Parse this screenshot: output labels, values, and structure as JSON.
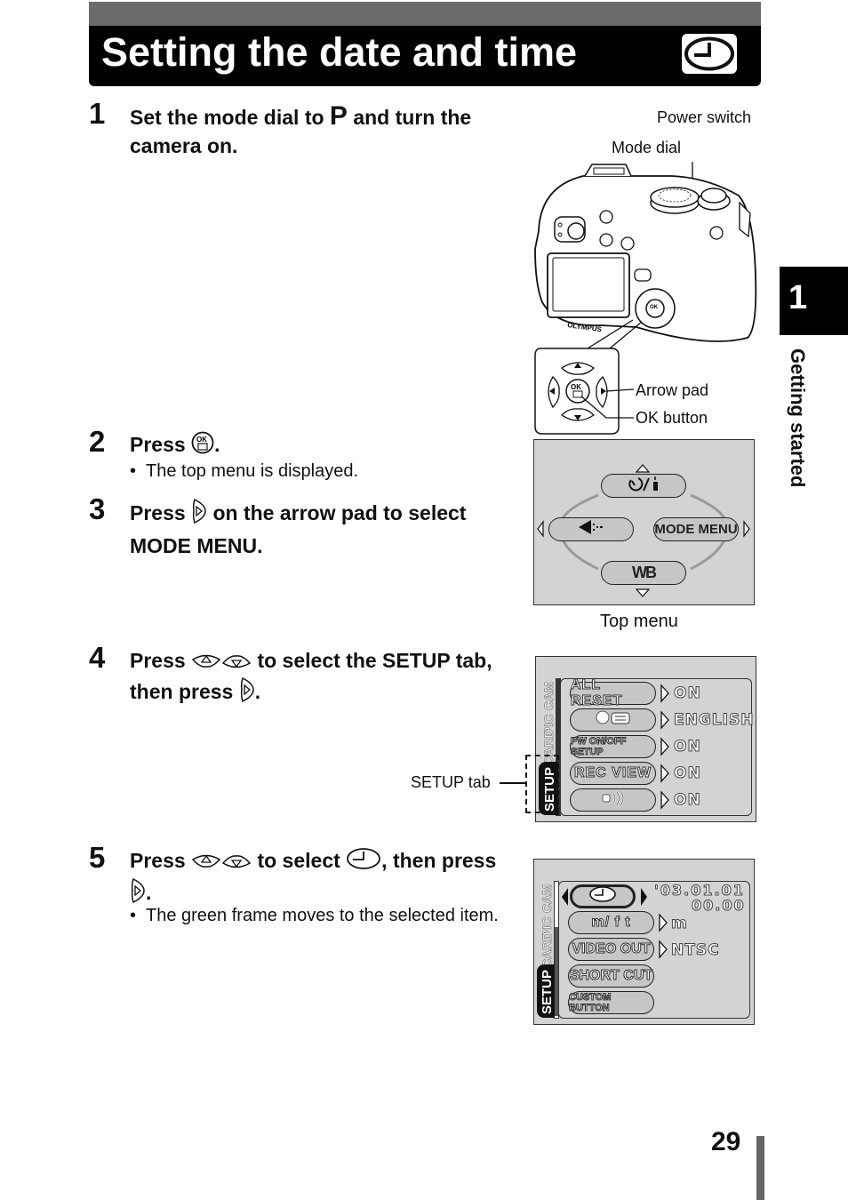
{
  "header": {
    "title": "Setting the date and time",
    "icon": "clock-icon"
  },
  "chapter": {
    "number": "1",
    "label": "Getting started"
  },
  "steps": [
    {
      "number": "1",
      "text_before": "Set the mode dial to ",
      "mode_glyph": "P",
      "text_after": " and turn the camera on."
    },
    {
      "number": "2",
      "text_before": "Press ",
      "icon": "ok-button-icon",
      "text_after": ".",
      "bullet": "The top menu is displayed."
    },
    {
      "number": "3",
      "text_before": "Press ",
      "icon": "right-arrow-button-icon",
      "text_after": " on the arrow pad to select MODE MENU."
    },
    {
      "number": "4",
      "text_before": "Press ",
      "icons": [
        "up-arrow-button-icon",
        "down-arrow-button-icon"
      ],
      "text_mid": " to select the SETUP tab, then press ",
      "icon2": "right-arrow-button-icon",
      "text_after": "."
    },
    {
      "number": "5",
      "text_before": "Press ",
      "icons": [
        "up-arrow-button-icon",
        "down-arrow-button-icon"
      ],
      "text_mid": " to select ",
      "icon2": "clock-icon",
      "text_mid2": ", then press ",
      "icon3": "right-arrow-button-icon",
      "text_after": ".",
      "bullet": "The green frame moves to the selected item."
    }
  ],
  "camera_figure": {
    "labels": {
      "power_switch": "Power switch",
      "mode_dial": "Mode dial",
      "arrow_pad": "Arrow pad",
      "ok_button": "OK button"
    },
    "brand": "OLYMPUS",
    "ok_text": "OK"
  },
  "top_menu": {
    "caption": "Top menu",
    "items": {
      "up": "self-timer-remote-icon",
      "left": "flash-compensation-icon",
      "right": "MODE  MENU",
      "down": "WB"
    }
  },
  "setup_screen_1": {
    "callout": "SETUP tab",
    "tabs": [
      "CAM",
      "PIC",
      "CARD",
      "SETUP"
    ],
    "rows": [
      {
        "label": "ALL  RESET",
        "value": "ON"
      },
      {
        "label": "language-icon",
        "value": "ENGLISH"
      },
      {
        "label": "PW ON/OFF SETUP",
        "value": "ON"
      },
      {
        "label": "REC  VIEW",
        "value": "ON"
      },
      {
        "label": "beep-icon",
        "value": "ON"
      }
    ]
  },
  "setup_screen_2": {
    "tabs": [
      "CAM",
      "PIC",
      "CARD",
      "SETUP"
    ],
    "rows": [
      {
        "label": "clock-icon",
        "value": "'03.01.01",
        "value2": "00.00"
      },
      {
        "label": "m/ f t",
        "value": "m"
      },
      {
        "label": "VIDEO  OUT",
        "value": "NTSC"
      },
      {
        "label": "SHORT  CUT",
        "value": ""
      },
      {
        "label": "CUSTOM  BUTTON",
        "value": ""
      }
    ]
  },
  "footer": {
    "page_number": "29"
  }
}
